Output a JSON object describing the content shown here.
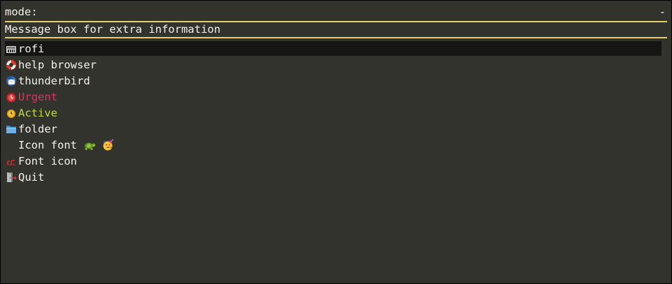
{
  "prompt": {
    "label": "mode:",
    "case_indicator": "-"
  },
  "message": "Message box for extra information",
  "items": [
    {
      "label": "rofi",
      "icon": "rofi-app-icon",
      "state": "selected"
    },
    {
      "label": "help browser",
      "icon": "lifebuoy-icon",
      "state": "normal"
    },
    {
      "label": "thunderbird",
      "icon": "thunderbird-icon",
      "state": "normal"
    },
    {
      "label": "Urgent",
      "icon": "alarm-clock-icon",
      "state": "urgent"
    },
    {
      "label": "Active",
      "icon": "clock-icon",
      "state": "active"
    },
    {
      "label": "folder",
      "icon": "folder-icon",
      "state": "normal"
    },
    {
      "label": "Icon font",
      "icon": "none",
      "state": "normal",
      "emoji": [
        "turtle-emoji",
        "party-face-emoji"
      ]
    },
    {
      "label": "Font icon",
      "icon": "font-glyph-icon",
      "state": "normal"
    },
    {
      "label": "Quit",
      "icon": "exit-door-icon",
      "state": "normal"
    }
  ],
  "colors": {
    "background": "#32332d",
    "foreground": "#f4f1ea",
    "separator": "#e3cf6c",
    "selected_background": "#151514",
    "urgent": "#e0315f",
    "active": "#bedc33"
  }
}
